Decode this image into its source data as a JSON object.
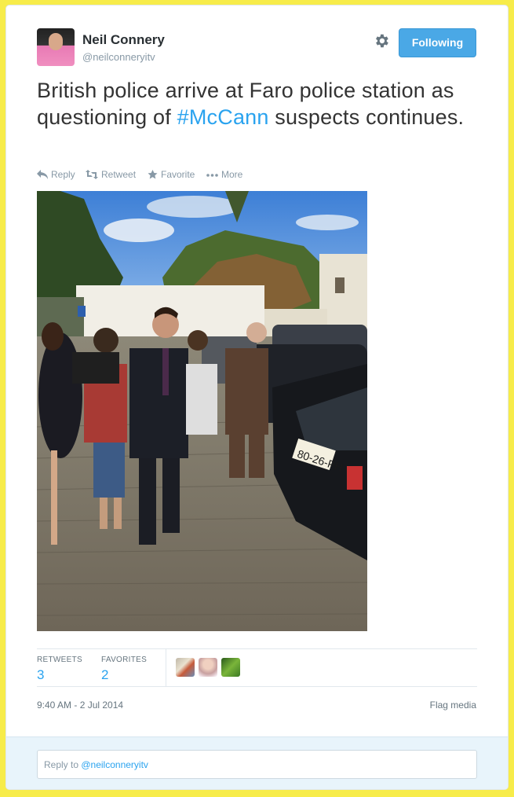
{
  "author": {
    "name": "Neil Connery",
    "handle": "@neilconneryitv",
    "follow_label": "Following"
  },
  "tweet": {
    "text_before": "British police arrive at Faro police station as questioning of ",
    "hashtag": "#McCann",
    "text_after": " suspects continues."
  },
  "actions": {
    "reply": "Reply",
    "retweet": "Retweet",
    "favorite": "Favorite",
    "more": "More"
  },
  "stats": {
    "retweets_label": "RETWEETS",
    "retweets_count": "3",
    "favorites_label": "FAVORITES",
    "favorites_count": "2"
  },
  "meta": {
    "timestamp": "9:40 AM - 2 Jul 2014",
    "flag_label": "Flag media"
  },
  "reply": {
    "prefix": "Reply to ",
    "mention": "@neilconneryitv"
  },
  "photo": {
    "plate_text": "80-26-PH"
  },
  "icons": [
    "gear-icon",
    "reply-icon",
    "retweet-icon",
    "star-icon",
    "more-icon"
  ],
  "colors": {
    "accent": "#2aa3ef",
    "follow_button": "#4aa8e6",
    "page_background": "#f7ec4a"
  }
}
